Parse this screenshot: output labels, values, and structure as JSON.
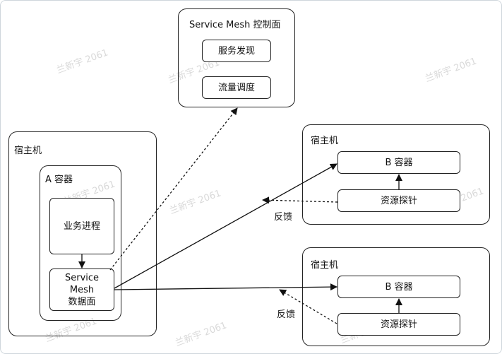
{
  "control_plane": {
    "title": "Service Mesh 控制面",
    "service_discovery": "服务发现",
    "traffic_scheduling": "流量调度"
  },
  "host_left": {
    "title": "宿主机",
    "container_title": "A 容器",
    "business_process": "业务进程",
    "data_plane_line1": "Service",
    "data_plane_line2": "Mesh",
    "data_plane_line3": "数据面"
  },
  "host_top_right": {
    "title": "宿主机",
    "container": "B 容器",
    "probe": "资源探针"
  },
  "host_bottom_right": {
    "title": "宿主机",
    "container": "B 容器",
    "probe": "资源探针"
  },
  "edges": {
    "feedback_top": "反馈",
    "feedback_bottom": "反馈"
  },
  "watermark": "兰新宇 2061"
}
